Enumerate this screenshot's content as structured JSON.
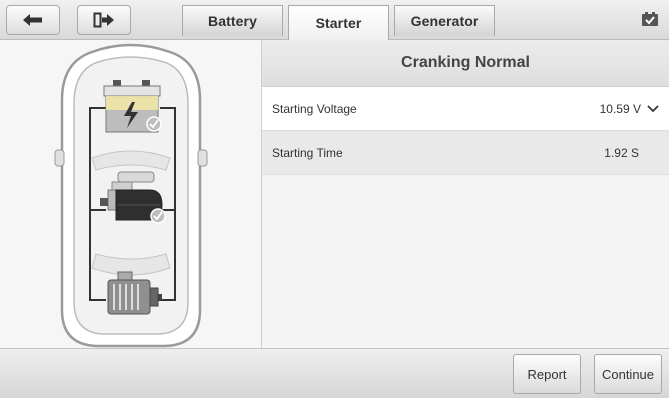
{
  "toolbar": {
    "back_icon": "back-arrow-icon",
    "exit_icon": "exit-icon",
    "status_icon": "vci-status-icon"
  },
  "tabs": [
    {
      "label": "Battery",
      "active": false
    },
    {
      "label": "Starter",
      "active": true
    },
    {
      "label": "Generator",
      "active": false
    }
  ],
  "diagram": {
    "components": [
      "battery",
      "starter-motor",
      "generator"
    ],
    "status": "checked"
  },
  "result": {
    "title": "Cranking Normal",
    "rows": [
      {
        "label": "Starting Voltage",
        "value": "10.59 V",
        "expandable": true
      },
      {
        "label": "Starting Time",
        "value": "1.92 S",
        "expandable": false
      }
    ]
  },
  "actions": {
    "report_label": "Report",
    "continue_label": "Continue"
  },
  "colors": {
    "check_green": "#bdbdbd",
    "battery_yellow": "#f3e9a6"
  }
}
